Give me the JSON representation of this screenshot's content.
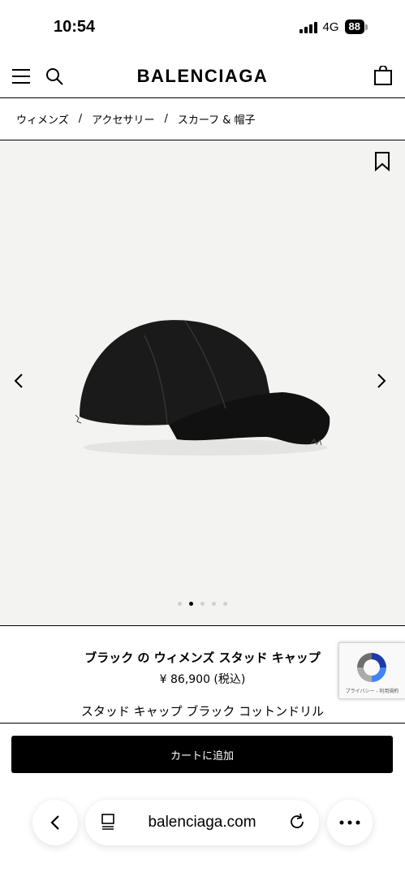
{
  "status_bar": {
    "time": "10:54",
    "network": "4G",
    "battery": "88"
  },
  "header": {
    "brand": "BALENCIAGA",
    "icons": [
      "menu-icon",
      "search-icon",
      "shopping-bag-icon"
    ]
  },
  "breadcrumb": {
    "items": [
      "ウィメンズ",
      "アクセサリー",
      "スカーフ & 帽子"
    ],
    "separator": "/"
  },
  "gallery": {
    "image_count": 5,
    "active_index": 1,
    "background": "#f3f3f1"
  },
  "product": {
    "name": "ブラック の ウィメンズ スタッド キャップ",
    "price": "¥ 86,900 (税込)",
    "description": "スタッド キャップ ブラック コットンドリル"
  },
  "recaptcha": {
    "label": "プライバシー - 利用規約"
  },
  "cart": {
    "label": "カートに追加"
  },
  "browser": {
    "url": "balenciaga.com"
  }
}
